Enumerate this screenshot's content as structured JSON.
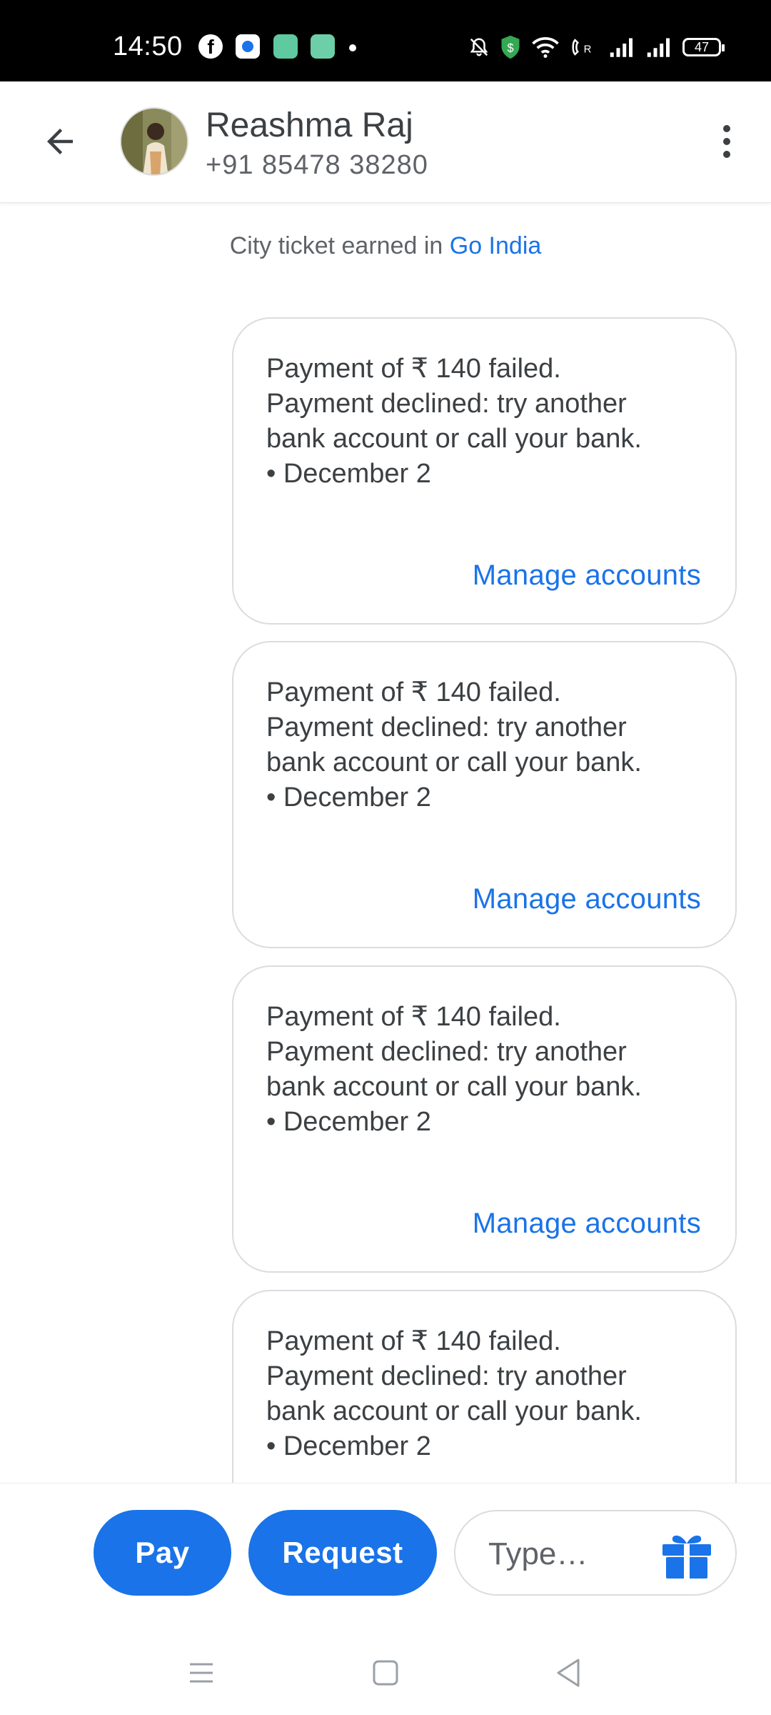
{
  "status_bar": {
    "time": "14:50",
    "left_icons": [
      "facebook-icon",
      "signal-app-icon",
      "app-icon",
      "app-icon",
      "more-notifications-dot"
    ],
    "right_icons": [
      "mute-icon",
      "shield-icon",
      "wifi-icon",
      "volte-icon",
      "signal-icon",
      "signal-icon"
    ],
    "battery": "47"
  },
  "header": {
    "contact_name": "Reashma Raj",
    "contact_phone": "+91 85478 38280"
  },
  "conversation": {
    "system_note_prefix": "City ticket earned in ",
    "system_note_link": "Go India",
    "messages": [
      {
        "line1": "Payment of ₹ 140 failed.",
        "line2": "Payment declined: try another",
        "line3": "bank account or call your bank.",
        "line4": "• December 2",
        "action": "Manage accounts"
      },
      {
        "line1": "Payment of ₹ 140 failed.",
        "line2": "Payment declined: try another",
        "line3": "bank account or call your bank.",
        "line4": "• December 2",
        "action": "Manage accounts"
      },
      {
        "line1": "Payment of ₹ 140 failed.",
        "line2": "Payment declined: try another",
        "line3": "bank account or call your bank.",
        "line4": "• December 2",
        "action": "Manage accounts"
      },
      {
        "line1": "Payment of ₹ 140 failed.",
        "line2": "Payment declined: try another",
        "line3": "bank account or call your bank.",
        "line4": "• December 2",
        "action": ""
      }
    ]
  },
  "bottom_bar": {
    "pay_label": "Pay",
    "request_label": "Request",
    "type_placeholder": "Type…",
    "type_value": ""
  },
  "colors": {
    "accent": "#1a73e8",
    "text": "#3c4043",
    "secondary_text": "#5f6368",
    "border": "#dadce0"
  }
}
